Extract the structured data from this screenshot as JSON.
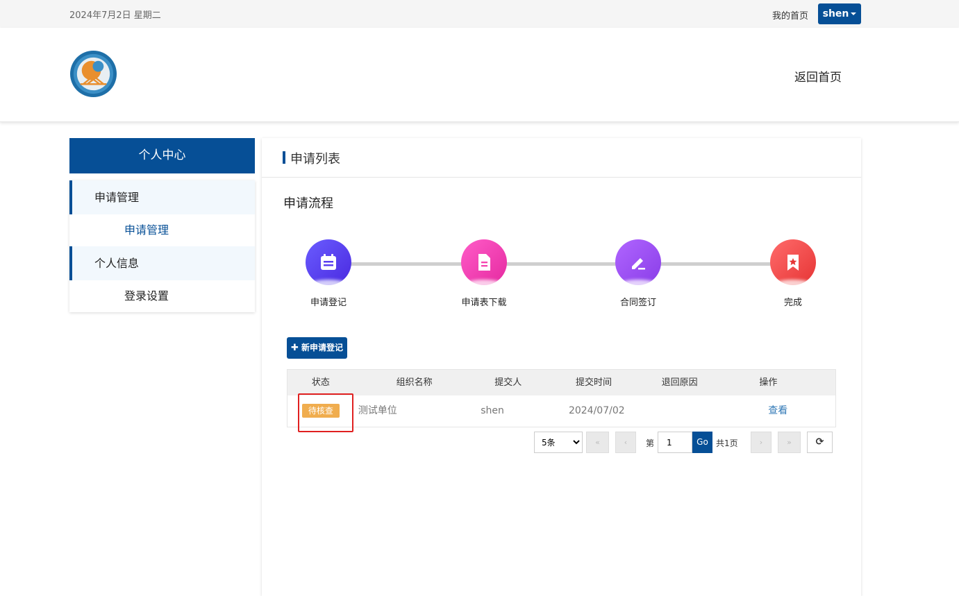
{
  "topbar": {
    "date": "2024年7月2日 星期二",
    "home_link": "我的首页",
    "user": "shen"
  },
  "header": {
    "back_home": "返回首页"
  },
  "sidebar": {
    "title": "个人中心",
    "groups": [
      {
        "label": "申请管理",
        "items": [
          {
            "label": "申请管理",
            "active": true
          }
        ]
      },
      {
        "label": "个人信息",
        "items": [
          {
            "label": "登录设置",
            "active": false
          }
        ]
      }
    ]
  },
  "main": {
    "panel_title": "申请列表",
    "flow_title": "申请流程",
    "steps": [
      {
        "label": "申请登记",
        "icon": "calendar-icon",
        "color": "#5a3ff0"
      },
      {
        "label": "申请表下载",
        "icon": "document-icon",
        "color": "#f545b0"
      },
      {
        "label": "合同签订",
        "icon": "edit-icon",
        "color": "#9b4ff0"
      },
      {
        "label": "完成",
        "icon": "bookmark-star-icon",
        "color": "#f04a4a"
      }
    ],
    "new_button": "新申请登记",
    "table": {
      "headers": [
        "状态",
        "组织名称",
        "提交人",
        "提交时间",
        "退回原因",
        "操作"
      ],
      "rows": [
        {
          "status": "待核查",
          "org": "测试单位",
          "submitter": "shen",
          "time": "2024/07/02",
          "reason": "",
          "action": "查看"
        }
      ]
    },
    "pager": {
      "page_size": "5条",
      "page_size_options": [
        "5条"
      ],
      "prefix": "第",
      "page": "1",
      "go": "Go",
      "total": "共1页"
    }
  },
  "colors": {
    "primary": "#064f96",
    "badge": "#f0ad4e",
    "highlight": "#e02020"
  }
}
